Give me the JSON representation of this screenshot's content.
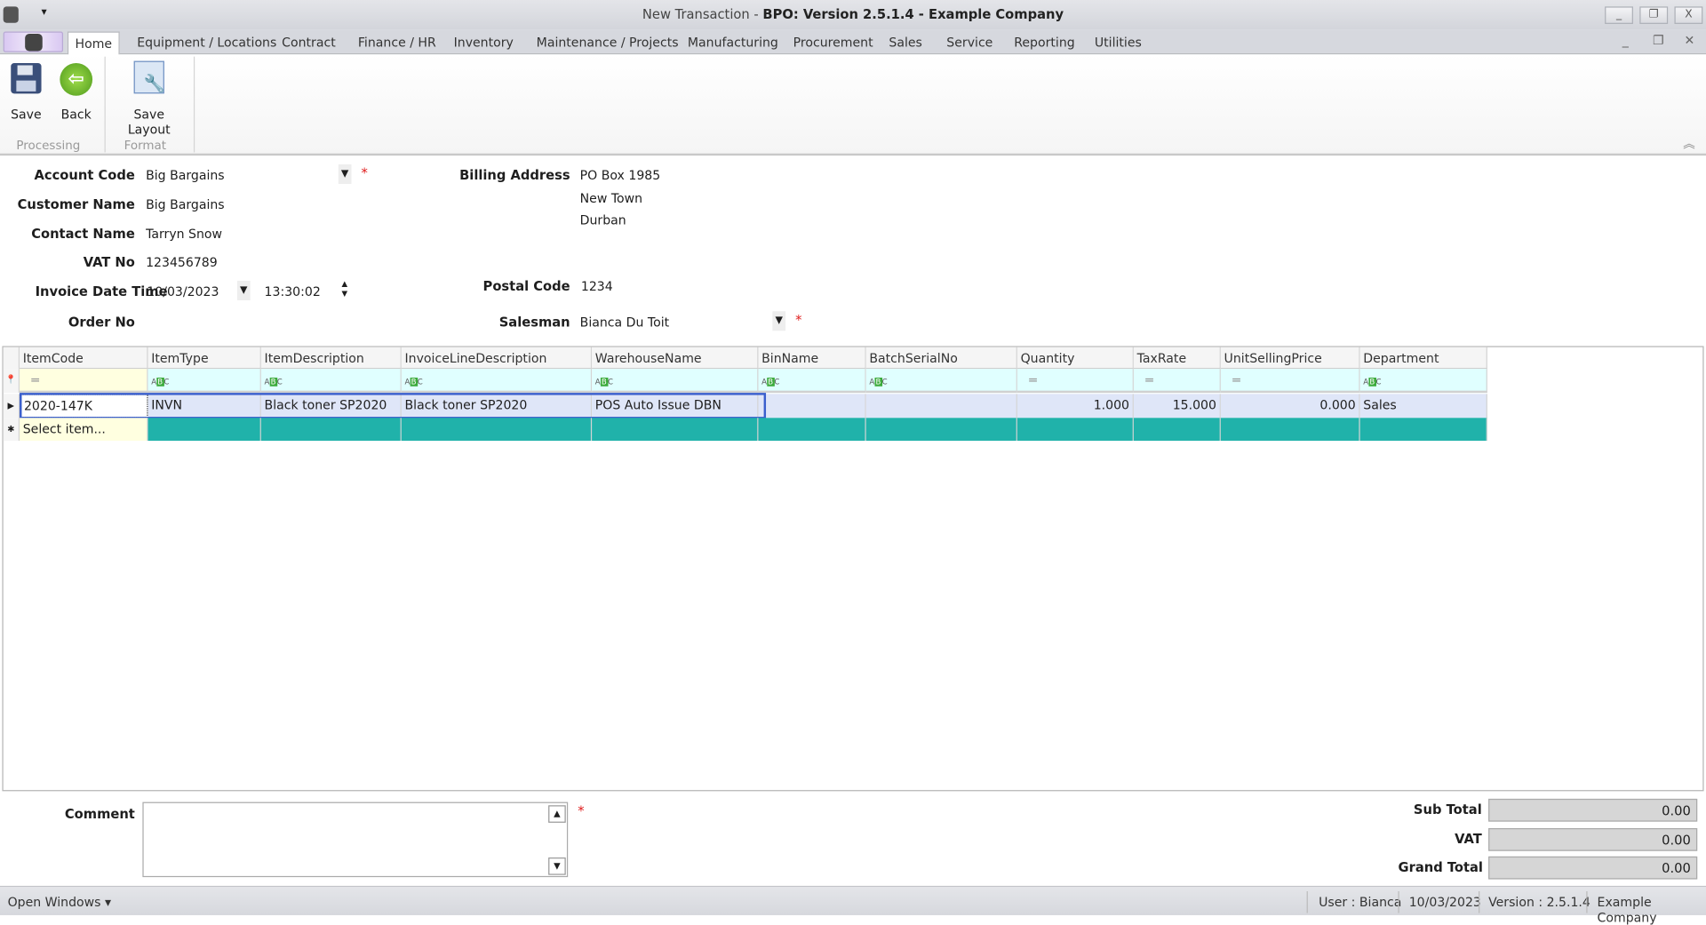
{
  "window": {
    "title_prefix": "New Transaction - ",
    "title_main": "BPO: Version 2.5.1.4 - Example Company",
    "minimize": "_",
    "restore": "❐",
    "close": "X"
  },
  "tabs": [
    "Home",
    "Equipment / Locations",
    "Contract",
    "Finance / HR",
    "Inventory",
    "Maintenance / Projects",
    "Manufacturing",
    "Procurement",
    "Sales",
    "Service",
    "Reporting",
    "Utilities"
  ],
  "ribbon": {
    "save": "Save",
    "back": "Back",
    "save_layout": "Save Layout",
    "group_processing": "Processing",
    "group_format": "Format"
  },
  "form": {
    "account_code_label": "Account Code",
    "account_code": "Big Bargains",
    "customer_name_label": "Customer Name",
    "customer_name": "Big Bargains",
    "contact_name_label": "Contact Name",
    "contact_name": "Tarryn Snow",
    "vat_no_label": "VAT No",
    "vat_no": "123456789",
    "invoice_dt_label": "Invoice Date Time",
    "invoice_date": "10/03/2023",
    "invoice_time": "13:30:02",
    "order_no_label": "Order No",
    "billing_label": "Billing Address",
    "billing_lines": [
      "PO Box 1985",
      "New Town",
      "Durban"
    ],
    "postal_label": "Postal Code",
    "postal_code": "1234",
    "salesman_label": "Salesman",
    "salesman": "Bianca Du Toit",
    "required": "*"
  },
  "grid": {
    "columns": [
      "ItemCode",
      "ItemType",
      "ItemDescription",
      "InvoiceLineDescription",
      "WarehouseName",
      "BinName",
      "BatchSerialNo",
      "Quantity",
      "TaxRate",
      "UnitSellingPrice",
      "Department"
    ],
    "filter_types": [
      "eq",
      "abc",
      "abc",
      "abc",
      "abc",
      "abc",
      "abc",
      "eq",
      "eq",
      "eq",
      "abc"
    ],
    "rows": [
      [
        "2020-147K",
        "INVN",
        "Black toner SP2020",
        "Black toner SP2020",
        "POS Auto Issue DBN",
        "",
        "",
        "1.000",
        "15.000",
        "0.000",
        "Sales"
      ]
    ],
    "new_row_placeholder": "Select item..."
  },
  "bottom": {
    "comment_label": "Comment",
    "comment": "",
    "sub_total_label": "Sub Total",
    "sub_total": "0.00",
    "vat_label": "VAT",
    "vat": "0.00",
    "grand_total_label": "Grand Total",
    "grand_total": "0.00"
  },
  "status": {
    "open_windows": "Open Windows ▾",
    "user": "User : Bianca",
    "date": "10/03/2023",
    "version": "Version : 2.5.1.4",
    "company": "Example Company"
  },
  "colors": {
    "new_row": "#20b2aa",
    "filter_row": "#e0ffff",
    "selected_row": "#dfe6f8",
    "focus": "#3a5fcd"
  }
}
